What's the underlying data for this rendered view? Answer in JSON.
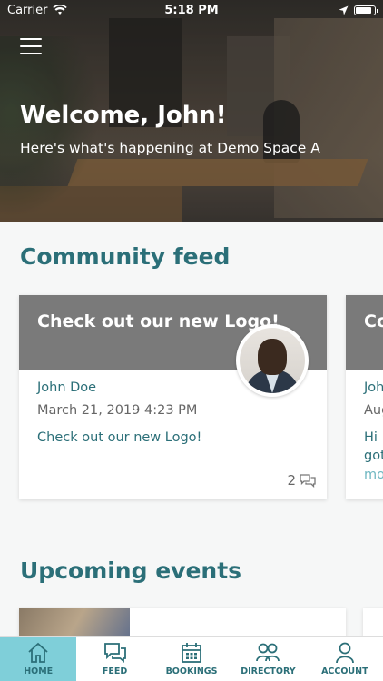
{
  "status_bar": {
    "carrier": "Carrier",
    "time": "5:18 PM"
  },
  "hero": {
    "welcome": "Welcome, John!",
    "subtitle": "Here's what's happening at Demo Space A"
  },
  "feed": {
    "title": "Community feed",
    "cards": [
      {
        "heading": "Check out our new Logo!",
        "author": "John Doe",
        "date": "March 21, 2019 4:23 PM",
        "body": "Check out our new Logo!",
        "comment_count": "2"
      },
      {
        "heading": "Co op",
        "author": "Joh",
        "date": "Aug",
        "body": "Hi",
        "body2": "got",
        "more": "mo"
      }
    ]
  },
  "events": {
    "title": "Upcoming events"
  },
  "tabs": [
    {
      "label": "HOME",
      "icon": "home-icon",
      "active": true
    },
    {
      "label": "FEED",
      "icon": "chat-icon",
      "active": false
    },
    {
      "label": "BOOKINGS",
      "icon": "calendar-icon",
      "active": false
    },
    {
      "label": "DIRECTORY",
      "icon": "people-icon",
      "active": false
    },
    {
      "label": "ACCOUNT",
      "icon": "person-icon",
      "active": false
    }
  ],
  "colors": {
    "accent": "#2b6f78",
    "active_tab": "#7fcfd9",
    "card_header": "#7a7a7a"
  }
}
